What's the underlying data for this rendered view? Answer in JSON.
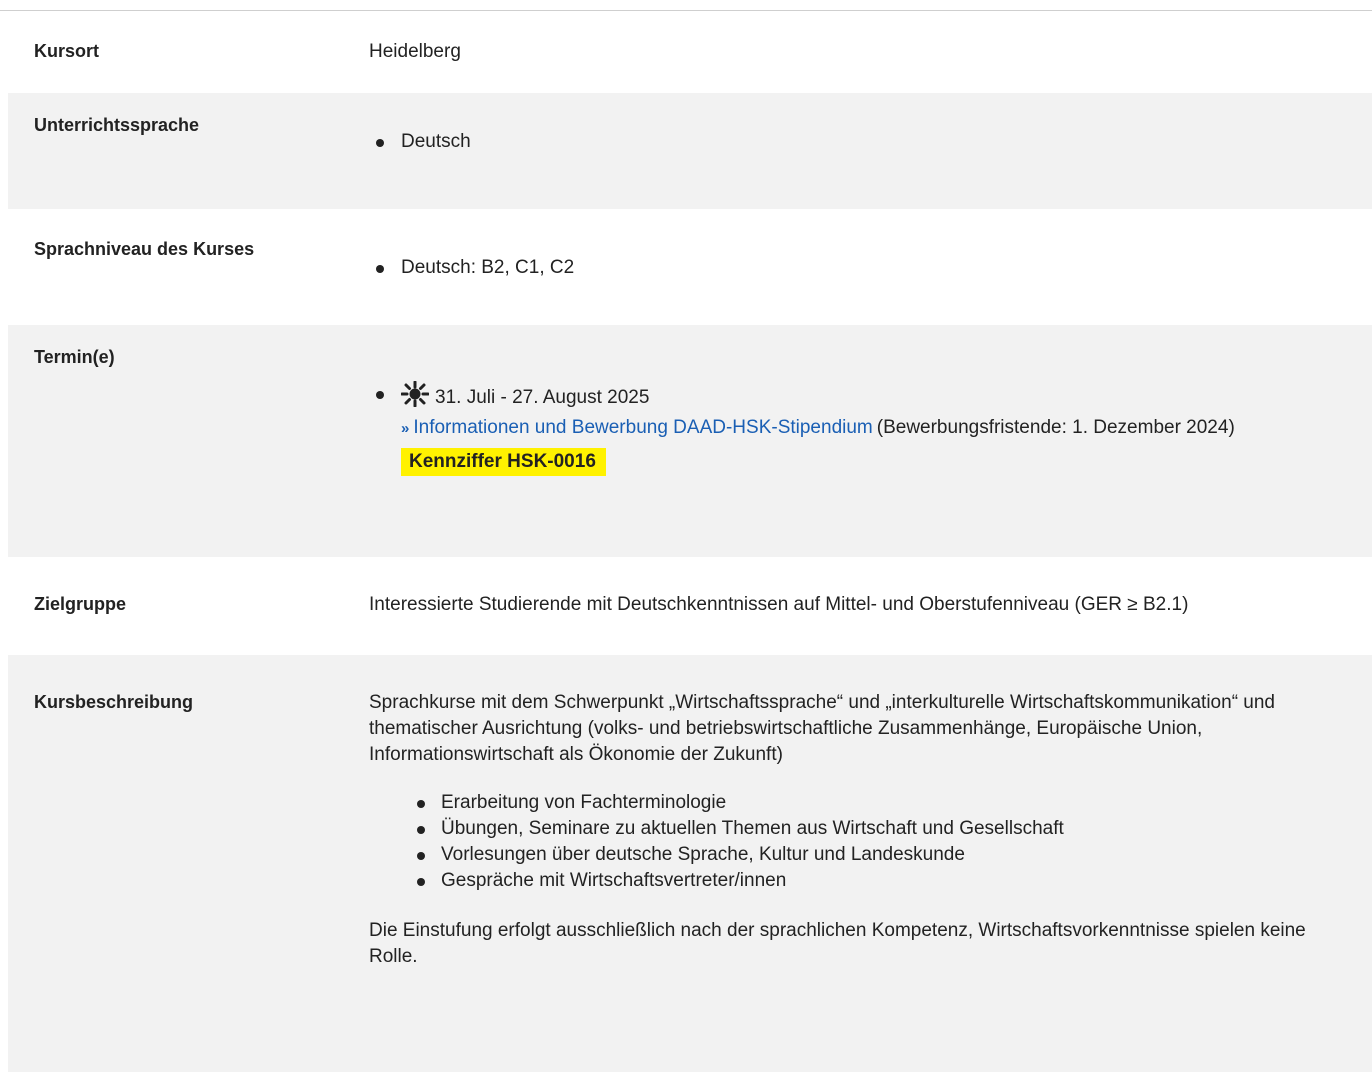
{
  "rows": {
    "kursort": {
      "label": "Kursort",
      "value": "Heidelberg"
    },
    "unterrichtssprache": {
      "label": "Unterrichtssprache",
      "items": [
        "Deutsch"
      ]
    },
    "sprachniveau": {
      "label": "Sprachniveau des Kurses",
      "items": [
        "Deutsch: B2, C1, C2"
      ]
    },
    "termine": {
      "label": "Termin(e)",
      "date": "31. Juli - 27. August 2025",
      "date_icon": "sun-icon",
      "link_text": "Informationen und Bewerbung DAAD-HSK-Stipendium",
      "link_suffix": "(Bewerbungsfristende: 1. Dezember 2024)",
      "code": "Kennziffer HSK-0016",
      "code_color": "#fff200"
    },
    "zielgruppe": {
      "label": "Zielgruppe",
      "value": "Interessierte Studierende mit Deutschkenntnissen auf Mittel- und Oberstufenniveau (GER ≥ B2.1)"
    },
    "kursbeschreibung": {
      "label": "Kursbeschreibung",
      "intro": "Sprachkurse mit dem Schwerpunkt „Wirtschaftssprache“ und „interkulturelle Wirtschaftskommunikation“ und thematischer Ausrichtung (volks- und betriebswirtschaftliche Zusammenhänge, Europäische Union, Informationswirtschaft als Ökonomie der Zukunft)",
      "items": [
        "Erarbeitung von Fachterminologie",
        "Übungen, Seminare zu aktuellen Themen aus Wirtschaft und Gesellschaft",
        "Vorlesungen über deutsche Sprache, Kultur und Landeskunde",
        "Gespräche mit Wirtschaftsvertreter/innen"
      ],
      "outro": "Die Einstufung erfolgt ausschließlich nach der sprachlichen Kompetenz, Wirtschaftsvorkenntnisse spielen keine Rolle."
    }
  },
  "colors": {
    "link": "#1a5fb4",
    "row_shade": "#f2f2f2",
    "highlight": "#fff200"
  }
}
